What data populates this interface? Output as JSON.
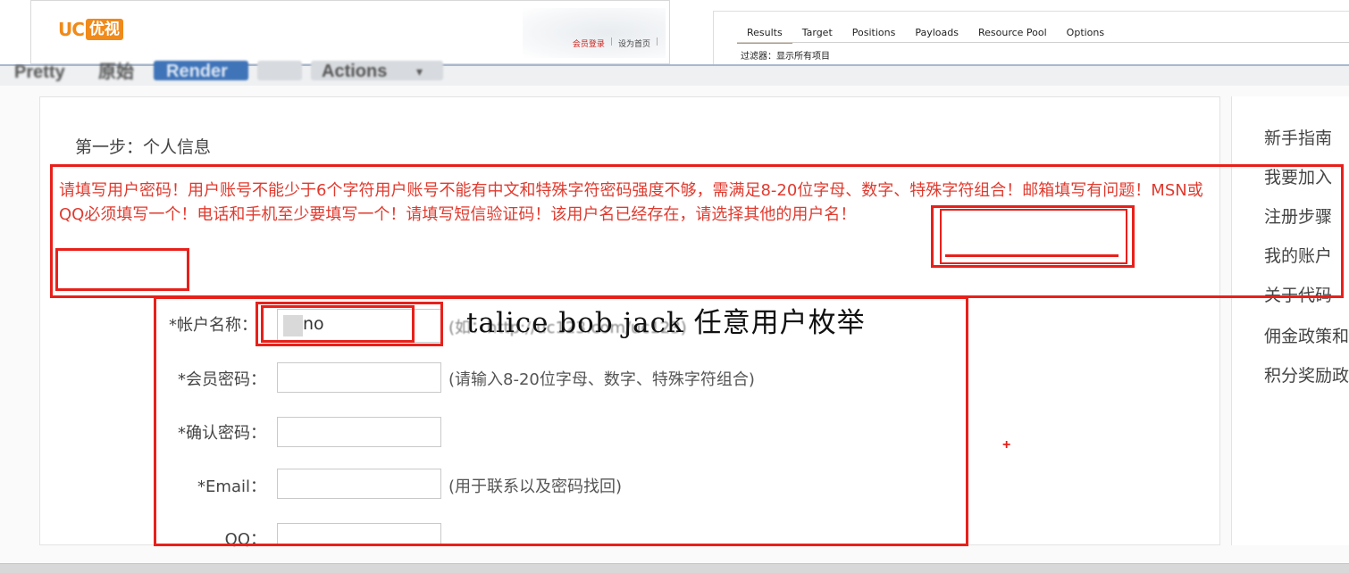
{
  "site_header": {
    "logo_latin": "UC",
    "logo_chinese": "优视",
    "links": [
      "会员登录",
      "设为首页"
    ]
  },
  "burp": {
    "tabs": [
      "Results",
      "Target",
      "Positions",
      "Payloads",
      "Resource Pool",
      "Options"
    ],
    "active_tab": "Results",
    "filter_text": "过滤器：显示所有项目"
  },
  "toolbar": {
    "items": [
      "Pretty",
      "原始",
      "Render",
      "Actions"
    ]
  },
  "form": {
    "step_title": "第一步：个人信息",
    "error_message": "请填写用户密码！用户账号不能少于6个字符用户账号不能有中文和特殊字符密码强度不够，需满足8-20位字母、数字、特殊字符组合！邮箱填写有问题！MSN或QQ必须填写一个！电话和手机至少要填写一个！请填写短信验证码！该用户名已经存在，请选择其他的用户名！",
    "fields": [
      {
        "label": "*帐户名称：",
        "value": "no",
        "hint": "(如：http://uc123.com/uc123)"
      },
      {
        "label": "*会员密码：",
        "value": "",
        "hint": "(请输入8-20位字母、数字、特殊字符组合)"
      },
      {
        "label": "*确认密码：",
        "value": "",
        "hint": ""
      },
      {
        "label": "*Email：",
        "value": "",
        "hint": "(用于联系以及密码找回)"
      },
      {
        "label": "QQ：",
        "value": "",
        "hint": ""
      }
    ]
  },
  "sidebar": {
    "items": [
      "新手指南",
      "我要加入",
      "注册步骤",
      "我的账户",
      "关于代码",
      "佣金政策和",
      "积分奖励政"
    ]
  },
  "annotation": {
    "text": "talice bob jack 任意用户枚举",
    "cursor": "+"
  },
  "colors": {
    "accent_red": "#e8201a",
    "error_text": "#e03a2e",
    "logo_orange": "#f08a1a",
    "burp_tab_underline": "#e58c25"
  }
}
